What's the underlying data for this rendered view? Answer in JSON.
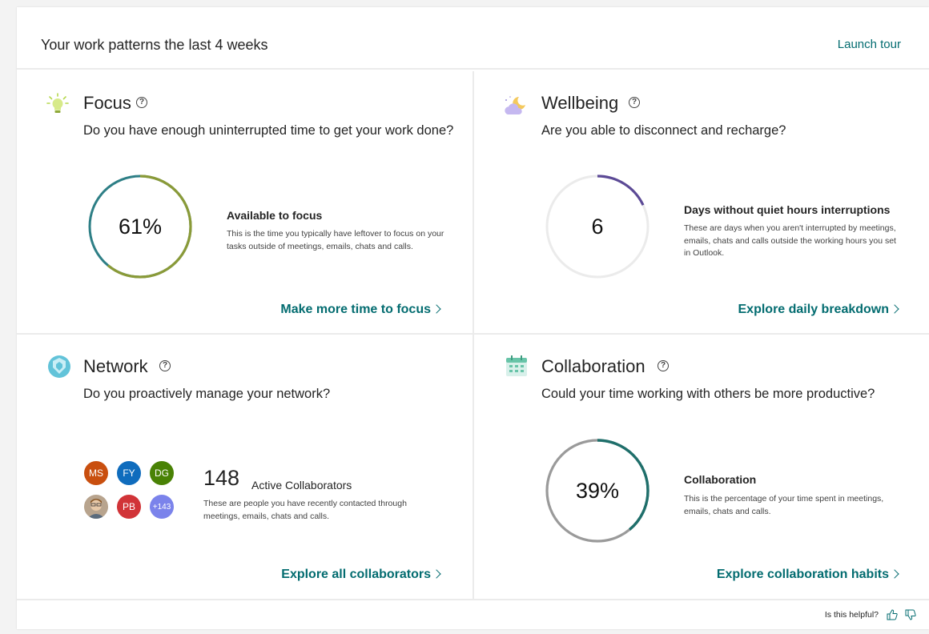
{
  "header": {
    "title": "Your work patterns the last 4 weeks",
    "launch_tour": "Launch tour"
  },
  "focus": {
    "title": "Focus",
    "question": "Do you have enough uninterrupted time to get your work done?",
    "value": "61%",
    "percent": 61,
    "stat_title": "Available to focus",
    "stat_desc": "This is the time you typically have leftover to focus on your tasks outside of meetings, emails, chats and calls.",
    "explore": "Make more time to focus"
  },
  "wellbeing": {
    "title": "Wellbeing",
    "question": "Are you able to disconnect and recharge?",
    "value": "6",
    "stat_title": "Days without quiet hours interruptions",
    "stat_desc": "These are days when you aren't interrupted by meetings, emails, chats and calls outside the working hours you set in Outlook.",
    "explore": "Explore daily breakdown"
  },
  "network": {
    "title": "Network",
    "question": "Do you proactively manage your network?",
    "count": "148",
    "count_label": "Active Collaborators",
    "stat_desc": "These are people you have recently contacted through meetings, emails, chats and calls.",
    "avatars": [
      {
        "initials": "MS",
        "color": "#c94f0f"
      },
      {
        "initials": "FY",
        "color": "#0f6cbd"
      },
      {
        "initials": "DG",
        "color": "#498205"
      },
      {
        "initials": "",
        "color": "#8a7a6a"
      },
      {
        "initials": "PB",
        "color": "#d13438"
      },
      {
        "initials": "+143",
        "color": "#7b83eb"
      }
    ],
    "explore": "Explore all collaborators"
  },
  "collaboration": {
    "title": "Collaboration",
    "question": "Could your time working with others be more productive?",
    "value": "39%",
    "percent": 39,
    "stat_title": "Collaboration",
    "stat_desc": "This is the percentage of your time spent in meetings, emails, chats and calls.",
    "explore": "Explore collaboration habits"
  },
  "footer": {
    "helpful": "Is this helpful?"
  },
  "colors": {
    "accent": "#036c70",
    "focus_green": "#8a9a38",
    "focus_teal": "#2e7f86",
    "wellbeing_purple": "#5c4a96",
    "collab_teal": "#1f6f6b",
    "ring_gray": "#9a9a9a"
  },
  "icons": {
    "focus": "lightbulb-icon",
    "wellbeing": "moon-cloud-icon",
    "network": "globe-icon",
    "collaboration": "calendar-icon",
    "help": "help-circle-icon"
  }
}
